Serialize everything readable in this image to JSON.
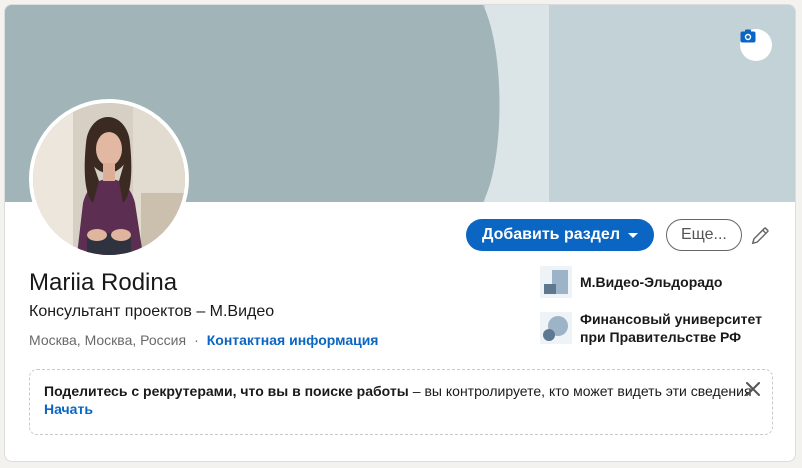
{
  "colors": {
    "accent": "#0a66c2",
    "banner_dark": "#a1b4b8",
    "banner_light": "#c2d2d6"
  },
  "banner": {
    "camera_icon": "camera-icon"
  },
  "profile": {
    "name": "Mariia Rodina",
    "headline": "Консультант проектов – М.Видео",
    "location": "Москва, Москва, Россия",
    "separator": "·",
    "contact_info": "Контактная информация"
  },
  "actions": {
    "add_section": "Добавить раздел",
    "more": "Еще...",
    "edit_icon": "pencil-icon"
  },
  "orgs": [
    {
      "name": "М.Видео-Эльдорадо"
    },
    {
      "name": "Финансовый университет при Правительстве РФ"
    }
  ],
  "open_to_work": {
    "bold_text": "Поделитесь с рекрутерами, что вы в поиске работы",
    "dash": "–",
    "rest_text": "вы контролируете, кто может видеть эти сведения",
    "start_link": "Начать",
    "close_icon": "close-icon"
  }
}
